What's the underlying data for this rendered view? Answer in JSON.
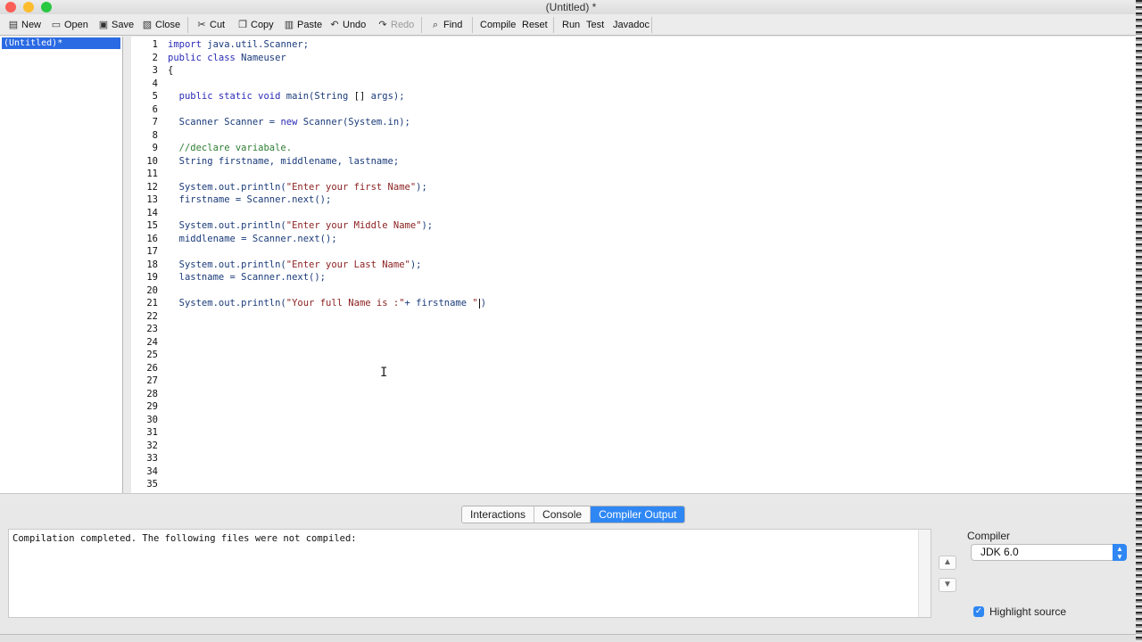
{
  "window": {
    "title": "(Untitled) *"
  },
  "toolbar": {
    "new": "New",
    "open": "Open",
    "save": "Save",
    "close": "Close",
    "cut": "Cut",
    "copy": "Copy",
    "paste": "Paste",
    "undo": "Undo",
    "redo": "Redo",
    "find": "Find",
    "compile": "Compile",
    "reset": "Reset",
    "run": "Run",
    "test": "Test",
    "javadoc": "Javadoc"
  },
  "documents": {
    "items": [
      {
        "label": "(Untitled)*"
      }
    ]
  },
  "editor": {
    "line_numbers": [
      "1",
      "2",
      "3",
      "4",
      "5",
      "6",
      "7",
      "8",
      "9",
      "10",
      "11",
      "12",
      "13",
      "14",
      "15",
      "16",
      "17",
      "18",
      "19",
      "20",
      "21",
      "22",
      "23",
      "24",
      "25",
      "26",
      "27",
      "28",
      "29",
      "30",
      "31",
      "32",
      "33",
      "34",
      "35"
    ],
    "code": {
      "l1a": "import",
      "l1b": " java.util.Scanner;",
      "l2a": "public class",
      "l2b": " Nameuser",
      "l3": "{",
      "l5a": "  public static void",
      "l5b": " main(String ",
      "l5c": "[]",
      "l5d": " args);",
      "l7a": "  Scanner Scanner = ",
      "l7b": "new",
      "l7c": " Scanner(System.in);",
      "l9": "  //declare variabale.",
      "l10": "  String firstname, middlename, lastname;",
      "l12a": "  System.out.println(",
      "l12b": "\"Enter your first Name\"",
      "l12c": ");",
      "l13": "  firstname = Scanner.next();",
      "l15a": "  System.out.println(",
      "l15b": "\"Enter your Middle Name\"",
      "l15c": ");",
      "l16": "  middlename = Scanner.next();",
      "l18a": "  System.out.println(",
      "l18b": "\"Enter your Last Name\"",
      "l18c": ");",
      "l19": "  lastname = Scanner.next();",
      "l21a": "  System.out.println(",
      "l21b": "\"Your full Name is :\"",
      "l21c": "+ firstname ",
      "l21d": "\"",
      "l21e": ")"
    }
  },
  "bottom_tabs": [
    {
      "label": "Interactions"
    },
    {
      "label": "Console"
    },
    {
      "label": "Compiler Output"
    }
  ],
  "output": {
    "text": "Compilation completed.  The following files were not compiled:"
  },
  "compiler": {
    "label": "Compiler",
    "selected": "JDK 6.0",
    "highlight_label": "Highlight source",
    "highlight_checked": true
  },
  "colors": {
    "accent": "#2f87f4",
    "selection": "#2a6ae3",
    "keyword": "#2a2ab8",
    "string": "#8a1e1e",
    "comment": "#2e7d32"
  }
}
